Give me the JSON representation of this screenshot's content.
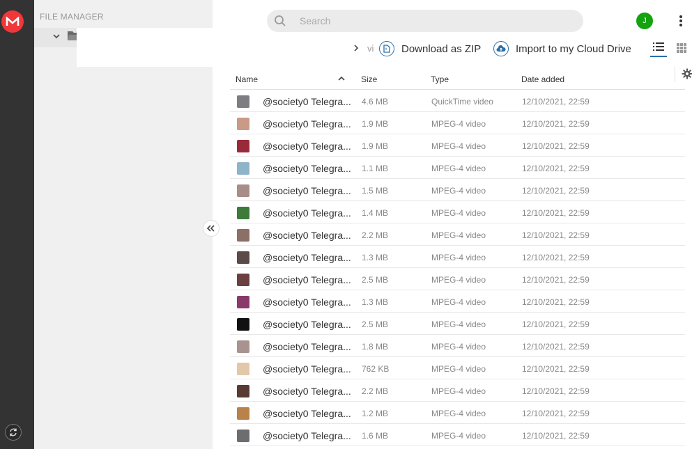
{
  "rail": {
    "logo_letter": "M",
    "brand_color": "#f0373a"
  },
  "side": {
    "title": "FILE MANAGER"
  },
  "search": {
    "placeholder": "Search"
  },
  "user": {
    "initial": "J",
    "color": "#13a30f"
  },
  "breadcrumb": {
    "text": "vi"
  },
  "actions": {
    "download_zip": "Download as ZIP",
    "import_cloud": "Import to my Cloud Drive"
  },
  "accent_color": "#2b6ea6",
  "table": {
    "headers": {
      "name": "Name",
      "size": "Size",
      "type": "Type",
      "date": "Date added"
    },
    "rows": [
      {
        "name": "@society0 Telegra...",
        "size": "4.6 MB",
        "type": "QuickTime video",
        "date": "12/10/2021, 22:59",
        "thumb": "#7d7d82"
      },
      {
        "name": "@society0 Telegra...",
        "size": "1.9 MB",
        "type": "MPEG-4 video",
        "date": "12/10/2021, 22:59",
        "thumb": "#c99a86"
      },
      {
        "name": "@society0 Telegra...",
        "size": "1.9 MB",
        "type": "MPEG-4 video",
        "date": "12/10/2021, 22:59",
        "thumb": "#9a2a3a"
      },
      {
        "name": "@society0 Telegra...",
        "size": "1.1 MB",
        "type": "MPEG-4 video",
        "date": "12/10/2021, 22:59",
        "thumb": "#8fb3c9"
      },
      {
        "name": "@society0 Telegra...",
        "size": "1.5 MB",
        "type": "MPEG-4 video",
        "date": "12/10/2021, 22:59",
        "thumb": "#a98d89"
      },
      {
        "name": "@society0 Telegra...",
        "size": "1.4 MB",
        "type": "MPEG-4 video",
        "date": "12/10/2021, 22:59",
        "thumb": "#3e7a3a"
      },
      {
        "name": "@society0 Telegra...",
        "size": "2.2 MB",
        "type": "MPEG-4 video",
        "date": "12/10/2021, 22:59",
        "thumb": "#8c6f66"
      },
      {
        "name": "@society0 Telegra...",
        "size": "1.3 MB",
        "type": "MPEG-4 video",
        "date": "12/10/2021, 22:59",
        "thumb": "#5a4a48"
      },
      {
        "name": "@society0 Telegra...",
        "size": "2.5 MB",
        "type": "MPEG-4 video",
        "date": "12/10/2021, 22:59",
        "thumb": "#6a4040"
      },
      {
        "name": "@society0 Telegra...",
        "size": "1.3 MB",
        "type": "MPEG-4 video",
        "date": "12/10/2021, 22:59",
        "thumb": "#8a3a6a"
      },
      {
        "name": "@society0 Telegra...",
        "size": "2.5 MB",
        "type": "MPEG-4 video",
        "date": "12/10/2021, 22:59",
        "thumb": "#111111"
      },
      {
        "name": "@society0 Telegra...",
        "size": "1.8 MB",
        "type": "MPEG-4 video",
        "date": "12/10/2021, 22:59",
        "thumb": "#a89390"
      },
      {
        "name": "@society0 Telegra...",
        "size": "762 KB",
        "type": "MPEG-4 video",
        "date": "12/10/2021, 22:59",
        "thumb": "#e2c7a8"
      },
      {
        "name": "@society0 Telegra...",
        "size": "2.2 MB",
        "type": "MPEG-4 video",
        "date": "12/10/2021, 22:59",
        "thumb": "#5a3b34"
      },
      {
        "name": "@society0 Telegra...",
        "size": "1.2 MB",
        "type": "MPEG-4 video",
        "date": "12/10/2021, 22:59",
        "thumb": "#b9824a"
      },
      {
        "name": "@society0 Telegra...",
        "size": "1.6 MB",
        "type": "MPEG-4 video",
        "date": "12/10/2021, 22:59",
        "thumb": "#6d6d70"
      }
    ]
  }
}
